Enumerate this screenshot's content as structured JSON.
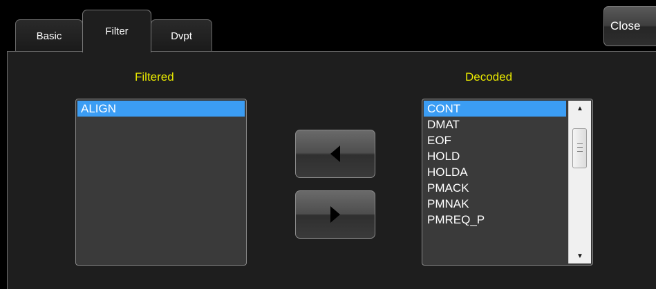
{
  "tabs": [
    {
      "label": "Basic",
      "active": false
    },
    {
      "label": "Filter",
      "active": true
    },
    {
      "label": "Dvpt",
      "active": false
    }
  ],
  "close_button": {
    "label": "Close"
  },
  "filtered": {
    "heading": "Filtered",
    "items": [
      "ALIGN"
    ],
    "selected_index": 0
  },
  "decoded": {
    "heading": "Decoded",
    "items": [
      "CONT",
      "DMAT",
      "EOF",
      "HOLD",
      "HOLDA",
      "PMACK",
      "PMNAK",
      "PMREQ_P"
    ],
    "selected_index": 0
  },
  "buttons": {
    "move_left_icon": "triangle-left-icon",
    "move_right_icon": "triangle-right-icon"
  },
  "colors": {
    "heading": "#e8e800",
    "selection": "#3b9df4",
    "panel": "#1e1e1e",
    "list_bg": "#3a3a3a"
  }
}
